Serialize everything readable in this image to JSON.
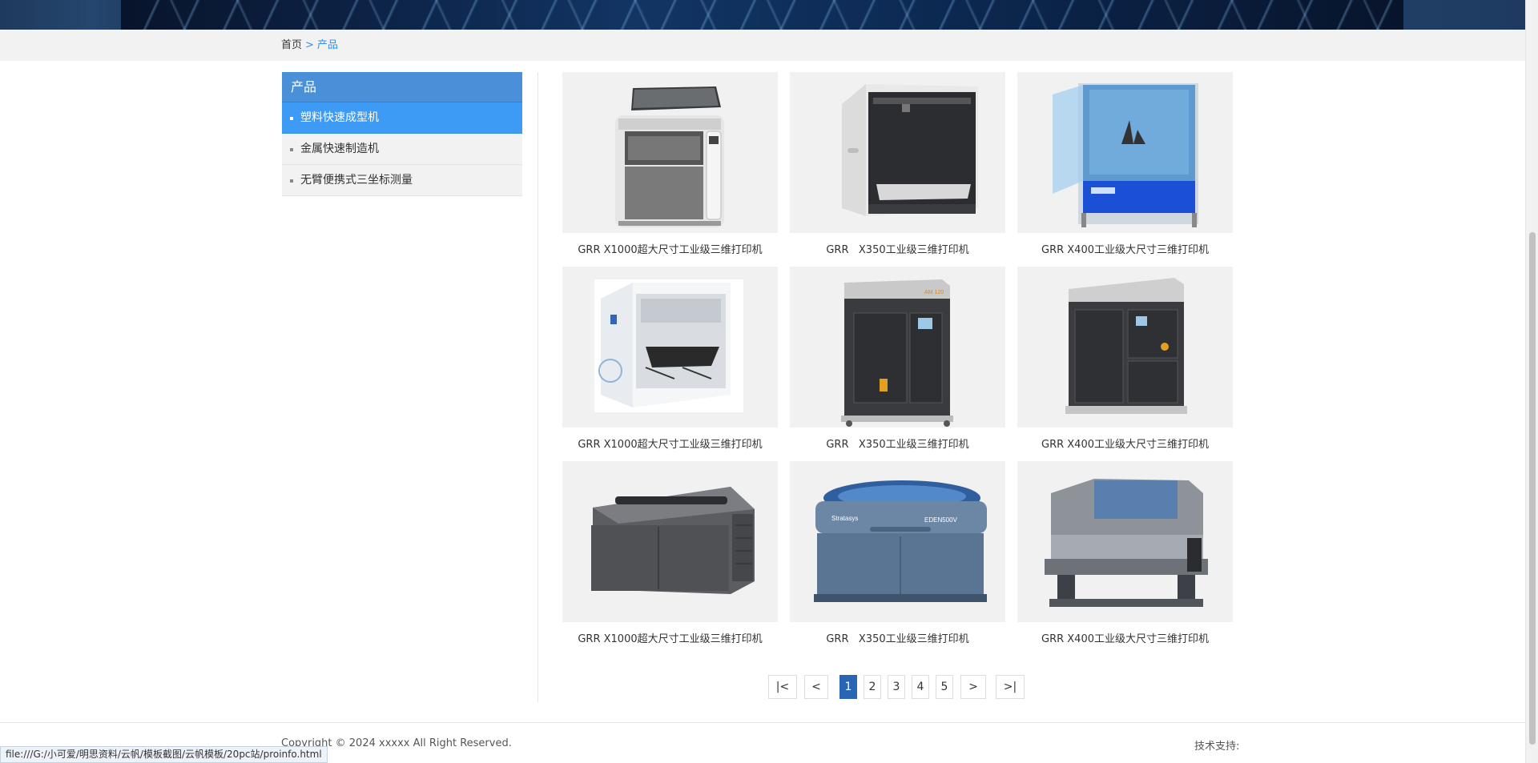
{
  "breadcrumb": {
    "home": "首页",
    "separator": ">",
    "current": "产品"
  },
  "sidebar": {
    "title": "产品",
    "items": [
      {
        "label": "塑料快速成型机",
        "active": true
      },
      {
        "label": "金属快速制造机",
        "active": false
      },
      {
        "label": "无臂便携式三坐标测量",
        "active": false
      }
    ]
  },
  "products": [
    {
      "caption": "GRR X1000超大尺寸工业级三维打印机",
      "icon": "printer-open-lid-image"
    },
    {
      "caption": "GRR   X350工业级三维打印机",
      "icon": "printer-frame-image"
    },
    {
      "caption": "GRR X400工业级大尺寸三维打印机",
      "icon": "printer-blue-enclosure-image"
    },
    {
      "caption": "GRR X1000超大尺寸工业级三维打印机",
      "icon": "printer-white-cube-image"
    },
    {
      "caption": "GRR   X350工业级三维打印机",
      "icon": "metal-printer-cabinet-image"
    },
    {
      "caption": "GRR X400工业级大尺寸三维打印机",
      "icon": "metal-printer-cabinet-image"
    },
    {
      "caption": "GRR X1000超大尺寸工业级三维打印机",
      "icon": "printer-dark-desktop-image"
    },
    {
      "caption": "GRR   X350工业级三维打印机",
      "icon": "printer-stratasys-eden-image"
    },
    {
      "caption": "GRR X400工业级大尺寸三维打印机",
      "icon": "printer-stratasys-grey-image"
    }
  ],
  "product_labels": {
    "eden_brand": "Stratasys",
    "eden_model": "EDEN500V",
    "cabinet_model": "AM 120"
  },
  "pagination": {
    "first": "|<",
    "prev": "<",
    "pages": [
      "1",
      "2",
      "3",
      "4",
      "5"
    ],
    "current": "1",
    "next": ">",
    "last": ">|"
  },
  "footer": {
    "copyright": "Copyright © 2024 xxxxx All Right Reserved.",
    "tech_support": "技术支持:"
  },
  "statusbar": {
    "url": "file:///G:/小可爱/明思资料/云帆/模板截图/云帆模板/20pc站/proinfo.html"
  },
  "colors": {
    "accent": "#4a90d9",
    "active_item": "#3d9bf5",
    "page_active": "#2a64b4",
    "link": "#3a8ee6"
  }
}
